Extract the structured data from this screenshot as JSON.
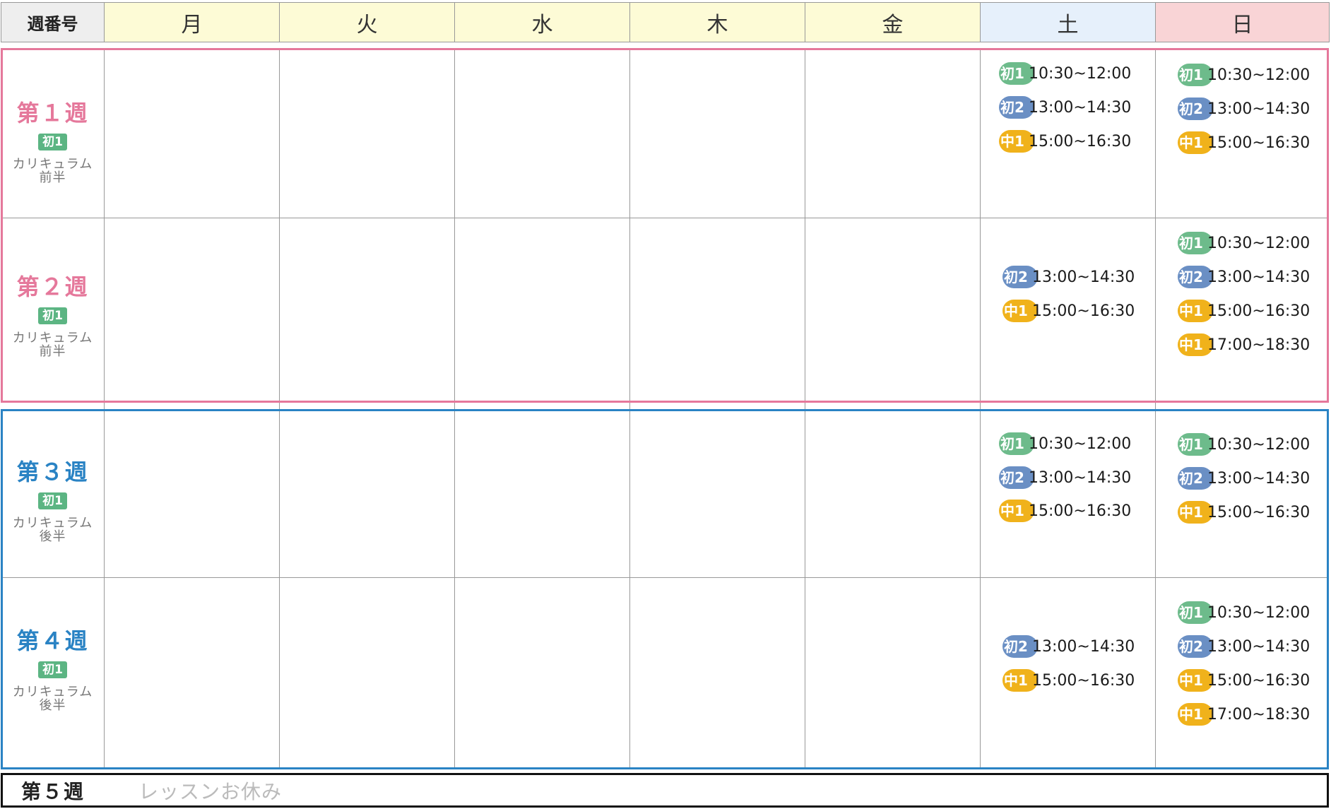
{
  "header": {
    "label": "週番号",
    "days": [
      "月",
      "火",
      "水",
      "木",
      "金",
      "土",
      "日"
    ]
  },
  "colors": {
    "first_half": "#e5789b",
    "second_half": "#2a83c4",
    "beginner1": "#6dbb8b",
    "beginner2": "#6a8fc4",
    "intermediate1": "#f0b21b"
  },
  "weeks": [
    {
      "title": "第１週",
      "level": "初1",
      "curriculum": [
        "カリキュラム",
        "前半"
      ],
      "sat": [
        {
          "tag": "初1",
          "time": "10:30~12:00"
        },
        {
          "tag": "初2",
          "time": "13:00~14:30"
        },
        {
          "tag": "中1",
          "time": "15:00~16:30"
        }
      ],
      "sun": [
        {
          "tag": "初1",
          "time": "10:30~12:00"
        },
        {
          "tag": "初2",
          "time": "13:00~14:30"
        },
        {
          "tag": "中1",
          "time": "15:00~16:30"
        }
      ]
    },
    {
      "title": "第２週",
      "level": "初1",
      "curriculum": [
        "カリキュラム",
        "前半"
      ],
      "sat": [
        {
          "tag": "初2",
          "time": "13:00~14:30"
        },
        {
          "tag": "中1",
          "time": "15:00~16:30"
        }
      ],
      "sun": [
        {
          "tag": "初1",
          "time": "10:30~12:00"
        },
        {
          "tag": "初2",
          "time": "13:00~14:30"
        },
        {
          "tag": "中1",
          "time": "15:00~16:30"
        },
        {
          "tag": "中1",
          "time": "17:00~18:30"
        }
      ]
    },
    {
      "title": "第３週",
      "level": "初1",
      "curriculum": [
        "カリキュラム",
        "後半"
      ],
      "sat": [
        {
          "tag": "初1",
          "time": "10:30~12:00"
        },
        {
          "tag": "初2",
          "time": "13:00~14:30"
        },
        {
          "tag": "中1",
          "time": "15:00~16:30"
        }
      ],
      "sun": [
        {
          "tag": "初1",
          "time": "10:30~12:00"
        },
        {
          "tag": "初2",
          "time": "13:00~14:30"
        },
        {
          "tag": "中1",
          "time": "15:00~16:30"
        }
      ]
    },
    {
      "title": "第４週",
      "level": "初1",
      "curriculum": [
        "カリキュラム",
        "後半"
      ],
      "sat": [
        {
          "tag": "初2",
          "time": "13:00~14:30"
        },
        {
          "tag": "中1",
          "time": "15:00~16:30"
        }
      ],
      "sun": [
        {
          "tag": "初1",
          "time": "10:30~12:00"
        },
        {
          "tag": "初2",
          "time": "13:00~14:30"
        },
        {
          "tag": "中1",
          "time": "15:00~16:30"
        },
        {
          "tag": "中1",
          "time": "17:00~18:30"
        }
      ]
    }
  ],
  "week5": {
    "title": "第５週",
    "note": "レッスンお休み"
  }
}
